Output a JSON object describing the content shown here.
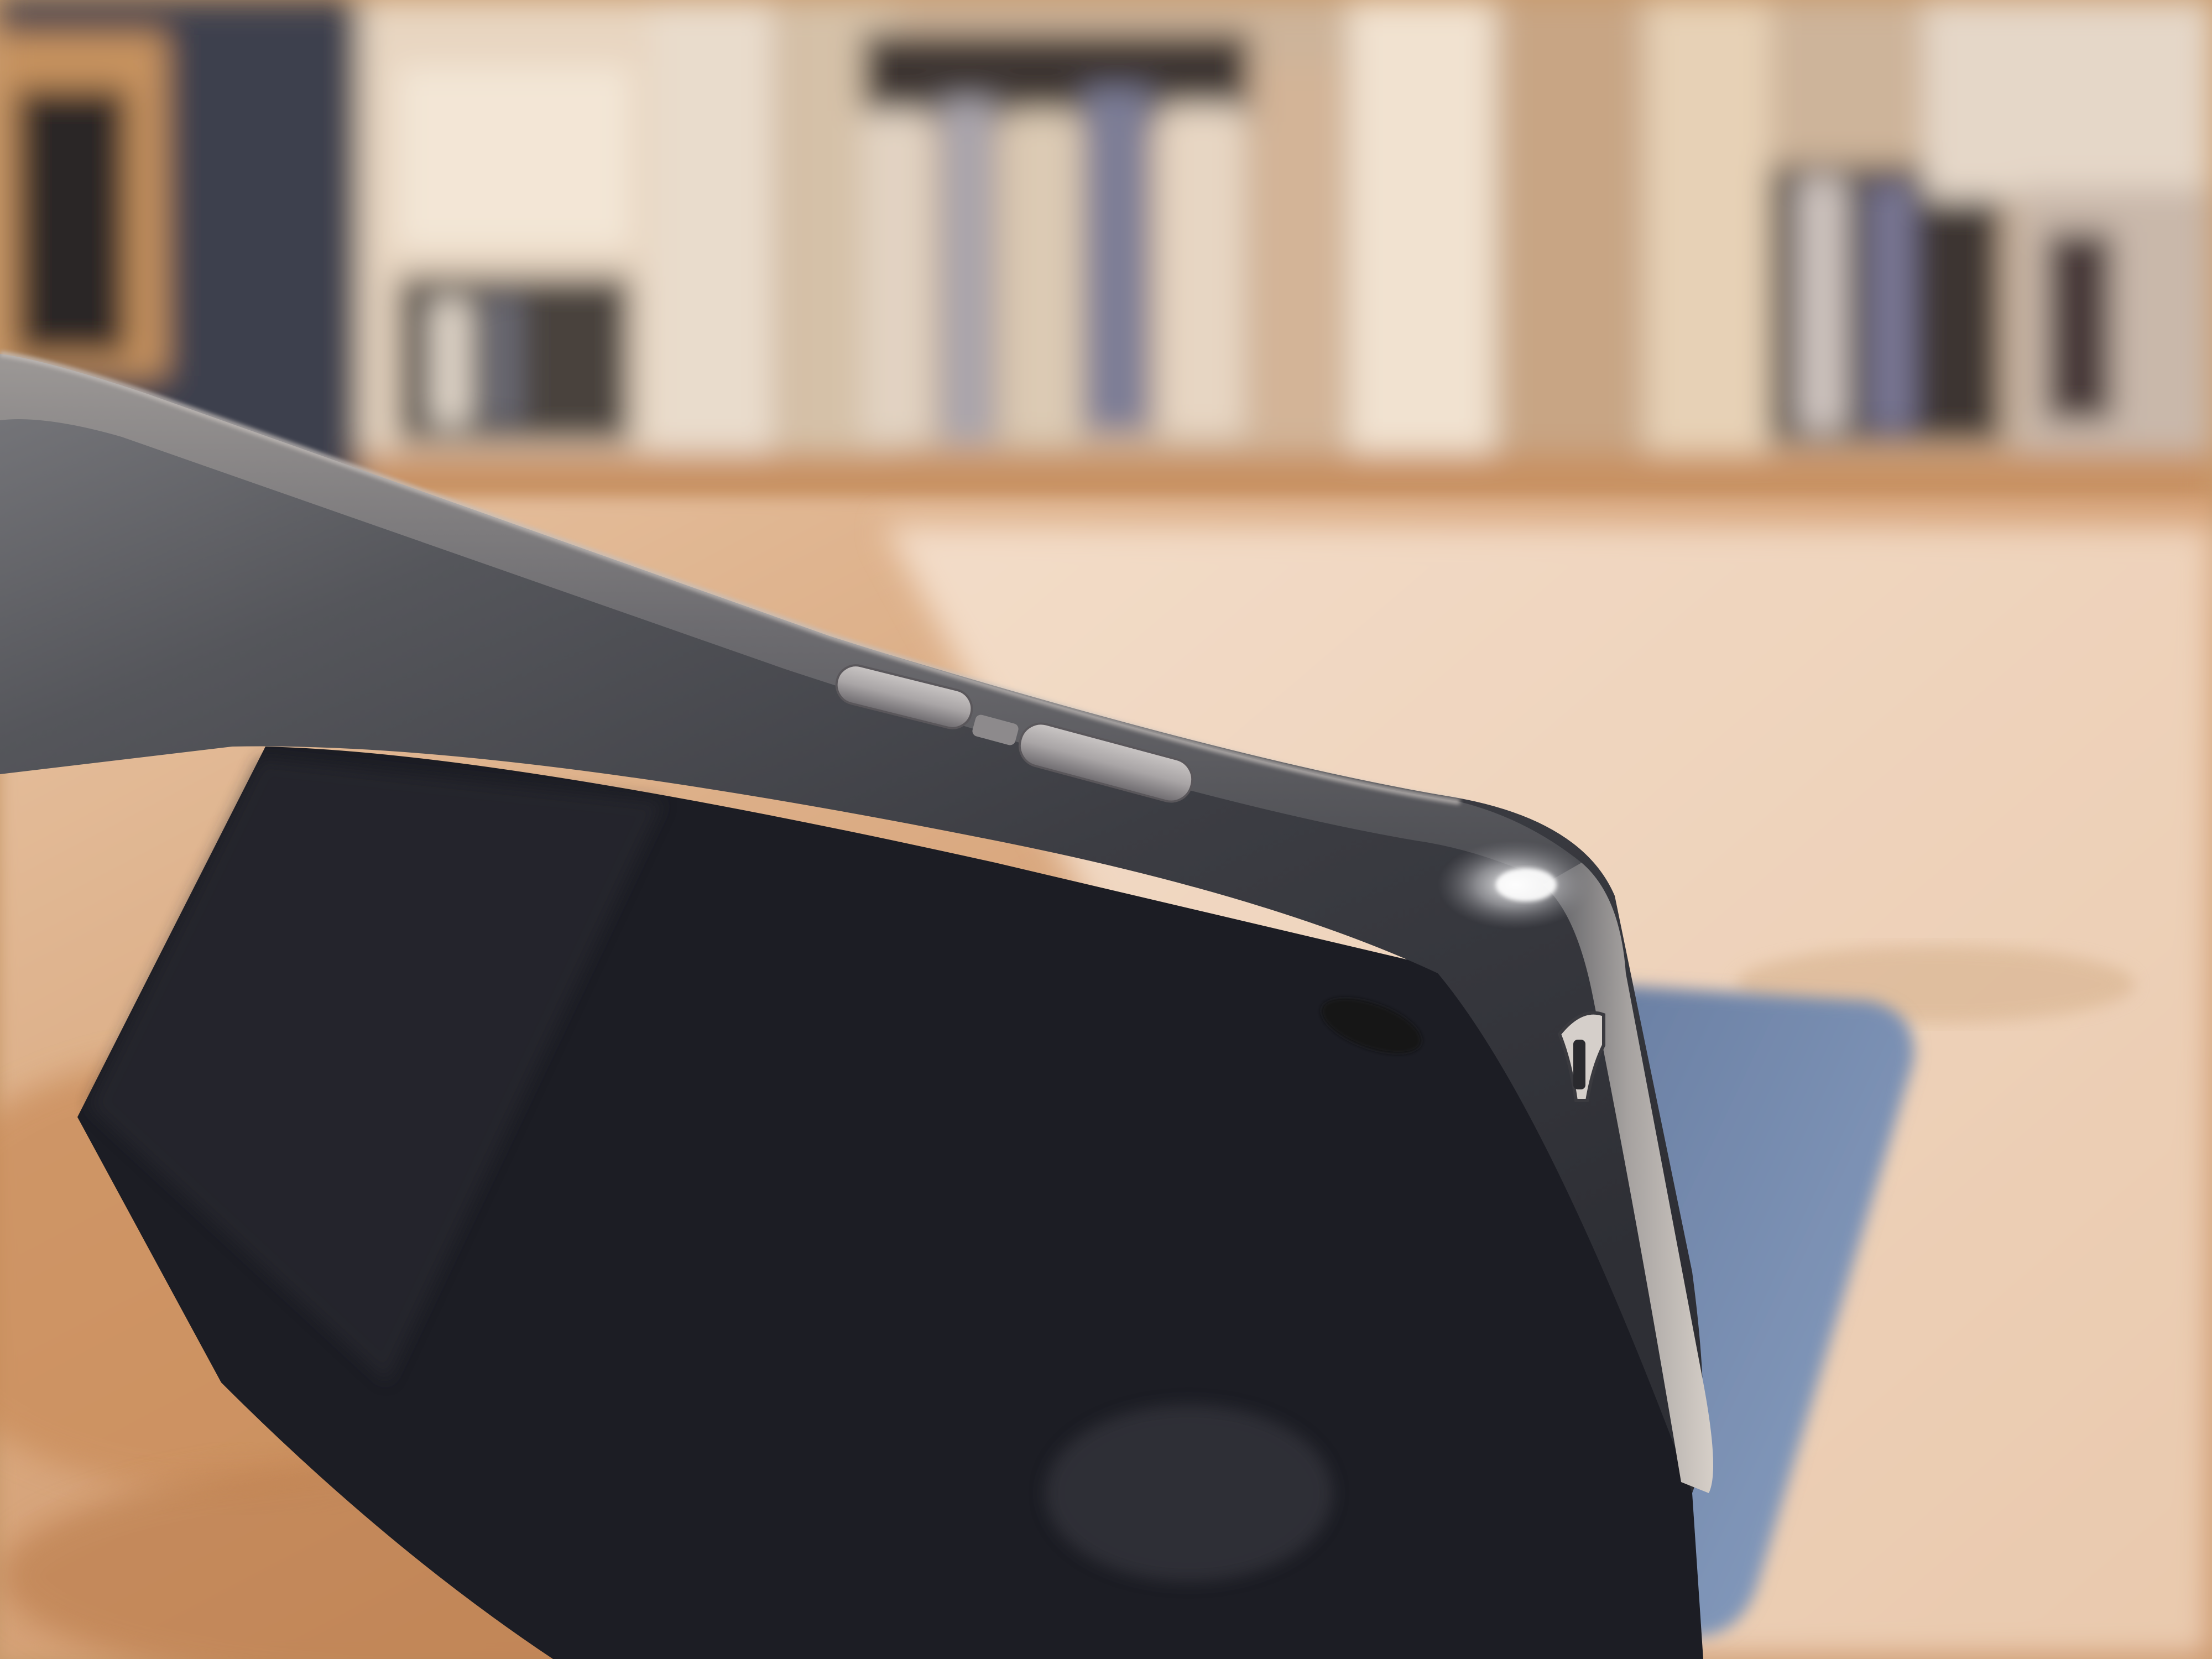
{
  "scene": {
    "subject": "tablet",
    "palette": {
      "table_wood": "#c8915e",
      "table_highlight": "#f0d4bc",
      "shelf_wood": "#d9b894",
      "shelf_shadow": "#4a3f38",
      "tablet_body_dark": "#3e3f44",
      "tablet_body_mid": "#6e6f74",
      "tablet_edge_light": "#d8d2cc",
      "tablet_screen": "#1a1b22",
      "button_metal": "#b8b4b2",
      "cover_blue": "#5a6f90",
      "wall_left": "#3b3e4a"
    },
    "elements": {
      "volume_up_button": "volume-up-button",
      "volume_down_button": "volume-down-button",
      "microphone_hole": "microphone-hole",
      "headphone_jack": "headphone-jack",
      "smart_cover": "smart-cover"
    }
  }
}
